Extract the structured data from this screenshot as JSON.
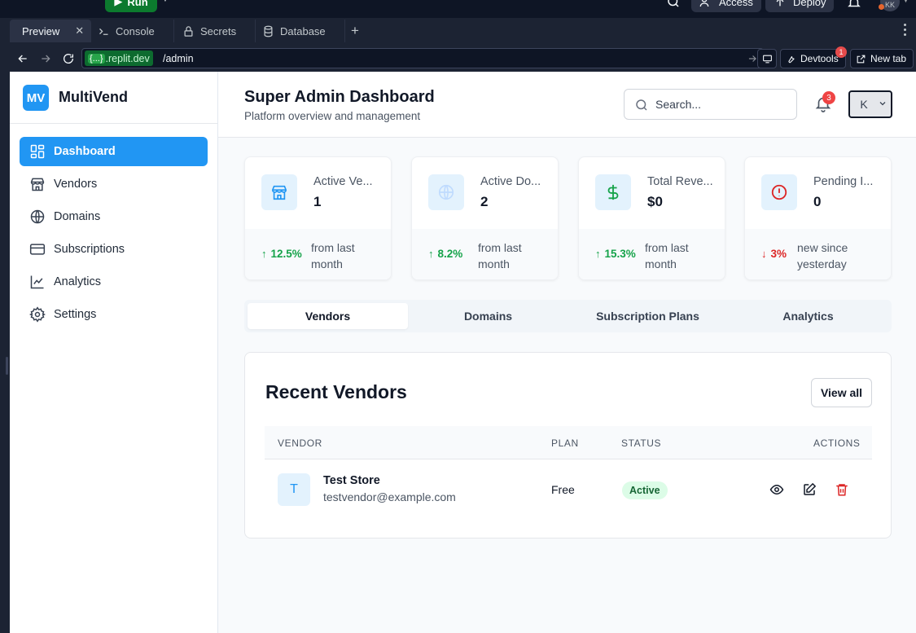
{
  "replit": {
    "run_label": "Run",
    "access_label": "Access",
    "deploy_label": "Deploy",
    "avatar_initials": "KK",
    "tabs": [
      {
        "label": "Preview",
        "icon": "monitor-icon"
      },
      {
        "label": "Console",
        "icon": "terminal-icon"
      },
      {
        "label": "Secrets",
        "icon": "lock-icon"
      },
      {
        "label": "Database",
        "icon": "database-icon"
      }
    ],
    "url_host_tag": "{...}",
    "url_host": ".replit.dev",
    "url_path": "/admin",
    "devtools_label": "Devtools",
    "devtools_badge": "1",
    "newtab_label": "New tab"
  },
  "brand": {
    "logo": "MV",
    "name": "MultiVend",
    "color": "#2196f3"
  },
  "sidebar": {
    "items": [
      {
        "label": "Dashboard",
        "icon": "dashboard-icon",
        "active": true
      },
      {
        "label": "Vendors",
        "icon": "store-icon"
      },
      {
        "label": "Domains",
        "icon": "globe-icon"
      },
      {
        "label": "Subscriptions",
        "icon": "credit-card-icon"
      },
      {
        "label": "Analytics",
        "icon": "line-chart-icon"
      },
      {
        "label": "Settings",
        "icon": "gear-icon"
      }
    ]
  },
  "header": {
    "title": "Super Admin Dashboard",
    "subtitle": "Platform overview and management",
    "search_placeholder": "Search...",
    "notification_count": "3",
    "user_initial": "K"
  },
  "stats": [
    {
      "label": "Active Ve...",
      "value": "1",
      "trend": "12.5%",
      "direction": "up",
      "note": "from last month",
      "icon": "store-icon",
      "icon_color": "#2196f3"
    },
    {
      "label": "Active Do...",
      "value": "2",
      "trend": "8.2%",
      "direction": "up",
      "note": "from last month",
      "icon": "globe-icon",
      "icon_color": "#bfdbfe"
    },
    {
      "label": "Total Reve...",
      "value": "$0",
      "trend": "15.3%",
      "direction": "up",
      "note": "from last month",
      "icon": "dollar-icon",
      "icon_color": "#16a34a"
    },
    {
      "label": "Pending I...",
      "value": "0",
      "trend": "3%",
      "direction": "down",
      "note": "new since yesterday",
      "icon": "alert-circle-icon",
      "icon_color": "#dc2626"
    }
  ],
  "tabs": [
    {
      "label": "Vendors",
      "active": true
    },
    {
      "label": "Domains"
    },
    {
      "label": "Subscription Plans"
    },
    {
      "label": "Analytics"
    }
  ],
  "recent_vendors": {
    "title": "Recent Vendors",
    "view_all": "View all",
    "columns": [
      "VENDOR",
      "PLAN",
      "STATUS",
      "ACTIONS"
    ],
    "rows": [
      {
        "initial": "T",
        "name": "Test Store",
        "email": "testvendor@example.com",
        "plan": "Free",
        "status": "Active"
      }
    ]
  },
  "colors": {
    "trend_up": "#16a34a",
    "trend_down": "#dc2626",
    "primary": "#2196f3"
  }
}
